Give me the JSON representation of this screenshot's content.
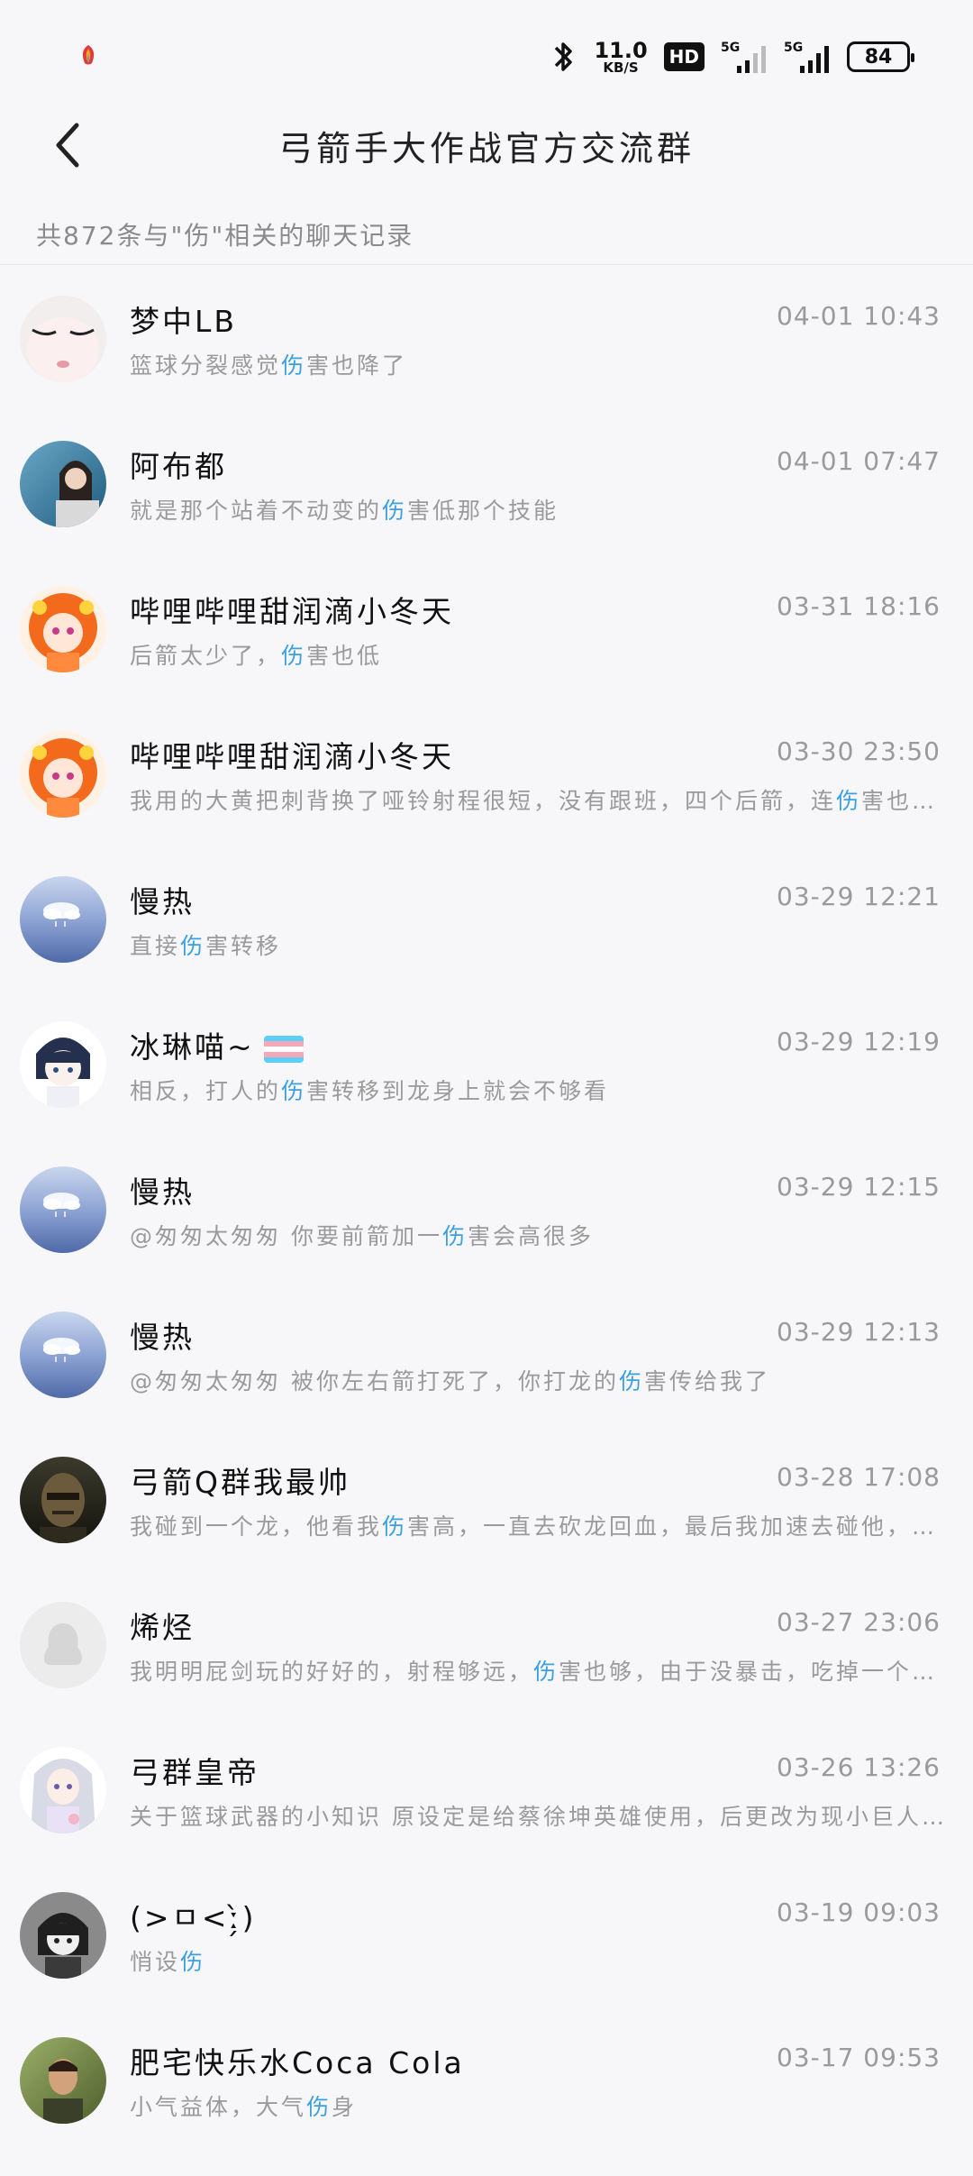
{
  "status_bar": {
    "net_speed_value": "11.0",
    "net_speed_unit": "KB/S",
    "hd_label": "HD",
    "signal1_label": "5G",
    "signal2_label": "5G",
    "battery": "84"
  },
  "header": {
    "title": "弓箭手大作战官方交流群"
  },
  "search": {
    "summary": "共872条与\"伤\"相关的聊天记录",
    "keyword": "伤",
    "highlight_color": "#3b9fe0"
  },
  "results": [
    {
      "name": "梦中LB",
      "time": "04-01 10:43",
      "snippet": "篮球分裂感觉伤害也降了",
      "avatar": "avatar-face-closeup"
    },
    {
      "name": "阿布都",
      "time": "04-01 07:47",
      "snippet": "就是那个站着不动变的伤害低那个技能",
      "avatar": "avatar-girl-seaside"
    },
    {
      "name": "哔哩哔哩甜润滴小冬天",
      "time": "03-31 18:16",
      "snippet": "后箭太少了，伤害也低",
      "avatar": "avatar-anime-orange-hair"
    },
    {
      "name": "哔哩哔哩甜润滴小冬天",
      "time": "03-30 23:50",
      "snippet": "我用的大黄把刺背换了哑铃射程很短，没有跟班，四个后箭，连伤害也不…",
      "avatar": "avatar-anime-orange-hair"
    },
    {
      "name": "慢热",
      "time": "03-29 12:21",
      "snippet": "直接伤害转移",
      "avatar": "avatar-blue-sky"
    },
    {
      "name": "冰琳喵~",
      "time": "03-29 12:19",
      "snippet": "相反，打人的伤害转移到龙身上就会不够看",
      "avatar": "avatar-anime-dark-hair",
      "flag": "transgender-flag-icon"
    },
    {
      "name": "慢热",
      "time": "03-29 12:15",
      "snippet": "@匆匆太匆匆 你要前箭加一伤害会高很多",
      "avatar": "avatar-blue-sky"
    },
    {
      "name": "慢热",
      "time": "03-29 12:13",
      "snippet": "@匆匆太匆匆 被你左右箭打死了，你打龙的伤害传给我了",
      "avatar": "avatar-blue-sky"
    },
    {
      "name": "弓箭Q群我最帅",
      "time": "03-28 17:08",
      "snippet": "我碰到一个龙，他看我伤害高，一直去砍龙回血，最后我加速去碰他，让…",
      "avatar": "avatar-man-dark"
    },
    {
      "name": "烯烃",
      "time": "03-27 23:06",
      "snippet": "我明明屁剑玩的好好的，射程够远，伤害也够，由于没暴击，吃掉一个…",
      "avatar": "avatar-default-penguin"
    },
    {
      "name": "弓群皇帝",
      "time": "03-26 13:26",
      "snippet": "关于篮球武器的小知识 原设定是给蔡徐坤英雄使用，后更改为现小巨人…",
      "avatar": "avatar-anime-silver-hair"
    },
    {
      "name": "(>ㅁ<ː̗̀)",
      "time": "03-19 09:03",
      "snippet": "悄设伤",
      "avatar": "avatar-anime-mono"
    },
    {
      "name": "肥宅快乐水Coca Cola",
      "time": "03-17 09:53",
      "snippet": "小气益体，大气伤身",
      "avatar": "avatar-man-outdoor"
    }
  ]
}
